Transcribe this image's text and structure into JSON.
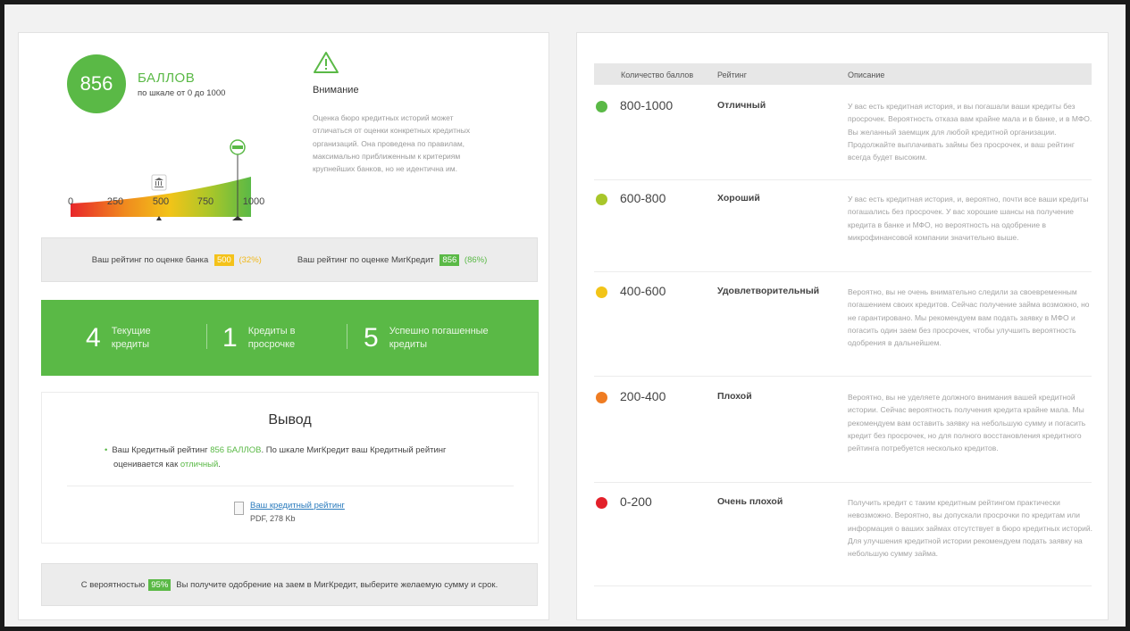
{
  "score": {
    "value": "856",
    "label": "БАЛЛОВ",
    "scale": "по шкале от 0 до 1000",
    "ticks": [
      "0",
      "250",
      "500",
      "750",
      "1000"
    ]
  },
  "warning": {
    "icon": "warning-triangle-icon",
    "title": "Внимание",
    "text": "Оценка бюро кредитных историй может отличаться от оценки конкретных кредитных организаций. Она проведена по правилам, максимально приближенным к критериям крупнейших банков, но не идентична им."
  },
  "rating_strip": {
    "bank_label": "Ваш рейтинг по оценке банка",
    "bank_value": "500",
    "bank_pct": "(32%)",
    "mig_label": "Ваш рейтинг по оценке МигКредит",
    "mig_value": "856",
    "mig_pct": "(86%)"
  },
  "stats": [
    {
      "num": "4",
      "label": "Текущие кредиты"
    },
    {
      "num": "1",
      "label": "Кредиты в просрочке"
    },
    {
      "num": "5",
      "label": "Успешно погашенные кредиты"
    }
  ],
  "conclusion": {
    "title": "Вывод",
    "part1": "Ваш Кредитный рейтинг ",
    "score_text": "856 БАЛЛОВ",
    "part2": ". По шкале МигКредит ваш Кредитный рейтинг оценивается как ",
    "rating_word": "отличный",
    "part3": ".",
    "pdf_link": "Ваш кредитный рейтинг",
    "pdf_size": "PDF, 278 Kb"
  },
  "approval": {
    "prefix": "С вероятностью",
    "pct": "95%",
    "suffix": "Вы получите одобрение на заем в МигКредит, выберите желаемую сумму и срок."
  },
  "table": {
    "headers": [
      "Количество баллов",
      "Рейтинг",
      "Описание"
    ],
    "rows": [
      {
        "range": "800-1000",
        "name": "Отличный",
        "color": "#5ab946",
        "desc": "У вас есть кредитная история, и вы погашали ваши кредиты без просрочек. Вероятность отказа вам крайне мала и в банке, и в МФО. Вы желанный заемщик для любой кредитной организации. Продолжайте выплачивать займы без просрочек, и ваш рейтинг всегда будет высоким."
      },
      {
        "range": "600-800",
        "name": "Хороший",
        "color": "#a8c62a",
        "desc": "У вас есть кредитная история, и, вероятно, почти все ваши кредиты погашались без просрочек. У вас хорошие шансы на получение кредита в банке и МФО, но вероятность на одобрение в микрофинансовой компании значительно выше."
      },
      {
        "range": "400-600",
        "name": "Удовлетворительный",
        "color": "#f2c418",
        "desc": "Вероятно, вы не очень внимательно следили за своевременным погашением своих кредитов. Сейчас получение займа возможно, но не гарантировано. Мы рекомендуем вам подать заявку в МФО и погасить один заем без просрочек, чтобы улучшить вероятность одобрения в дальнейшем."
      },
      {
        "range": "200-400",
        "name": "Плохой",
        "color": "#ef7c22",
        "desc": "Вероятно, вы не уделяете должного внимания вашей кредитной истории. Сейчас вероятность получения кредита крайне мала. Мы рекомендуем вам оставить заявку на небольшую сумму и погасить кредит без просрочек, но для полного восстановления кредитного рейтинга потребуется несколько кредитов."
      },
      {
        "range": "0-200",
        "name": "Очень плохой",
        "color": "#e3202a",
        "desc": "Получить кредит с таким кредитным рейтингом практически невозможно. Вероятно, вы допускали просрочки по кредитам или информация о ваших займах отсутствует в бюро кредитных историй. Для улучшения кредитной истории рекомендуем подать заявку на небольшую сумму займа."
      }
    ]
  }
}
